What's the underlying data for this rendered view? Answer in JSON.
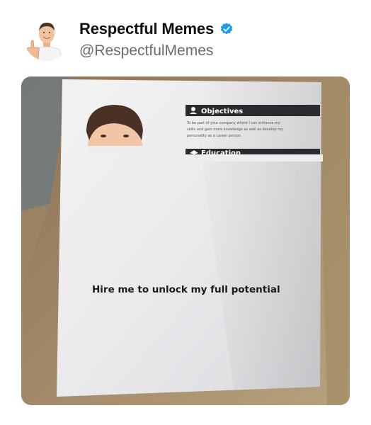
{
  "post": {
    "display_name": "Respectful Memes",
    "handle": "@RespectfulMemes",
    "verified_icon": "verified-badge-icon",
    "verified_color": "#1d9bf0"
  },
  "resume": {
    "section_objectives": "Objectives",
    "objectives_text": [
      "To be part of your company where I can enhance my",
      "skills and gain more knowledge as well as develop my",
      "personality as a career person."
    ],
    "section_education": "Education",
    "overlay_text": "Hire me to unlock my full potential"
  }
}
